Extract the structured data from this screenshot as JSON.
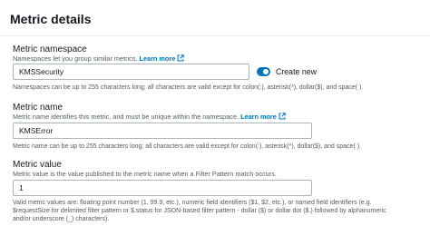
{
  "panel": {
    "title": "Metric details"
  },
  "namespace": {
    "label": "Metric namespace",
    "description": "Namespaces let you group similar metrics.",
    "learn_more": "Learn more",
    "value": "KMSSecurity",
    "toggle_label": "Create new",
    "toggle_on": true,
    "constraint": "Namespaces can be up to 255 characters long; all characters are valid except for colon(:), asterisk(*), dollar($), and space( )."
  },
  "metric_name": {
    "label": "Metric name",
    "description": "Metric name identifies this metric, and must be unique within the namespace.",
    "learn_more": "Learn more",
    "value": "KMSError",
    "constraint": "Metric name can be up to 255 characters long; all characters are valid except for colon(:), asterisk(*), dollar($), and space( )."
  },
  "metric_value": {
    "label": "Metric value",
    "description": "Metric value is the value published to the metric name when a Filter Pattern match occurs.",
    "value": "1",
    "constraint_lines": [
      "Valid metric values are: floating point number (1, 99.9, etc.), numeric field identifiers ($1, $2, etc.), or named field identifiers (e.g.",
      "$requestSize for delimited filter pattern or $.status for JSON-based filter pattern - dollar ($) or dollar dot ($.) followed by alphanumeric",
      "and/or underscore (_) characters)."
    ]
  },
  "colors": {
    "accent": "#0073bb",
    "text": "#16191f",
    "secondary": "#545b64"
  }
}
